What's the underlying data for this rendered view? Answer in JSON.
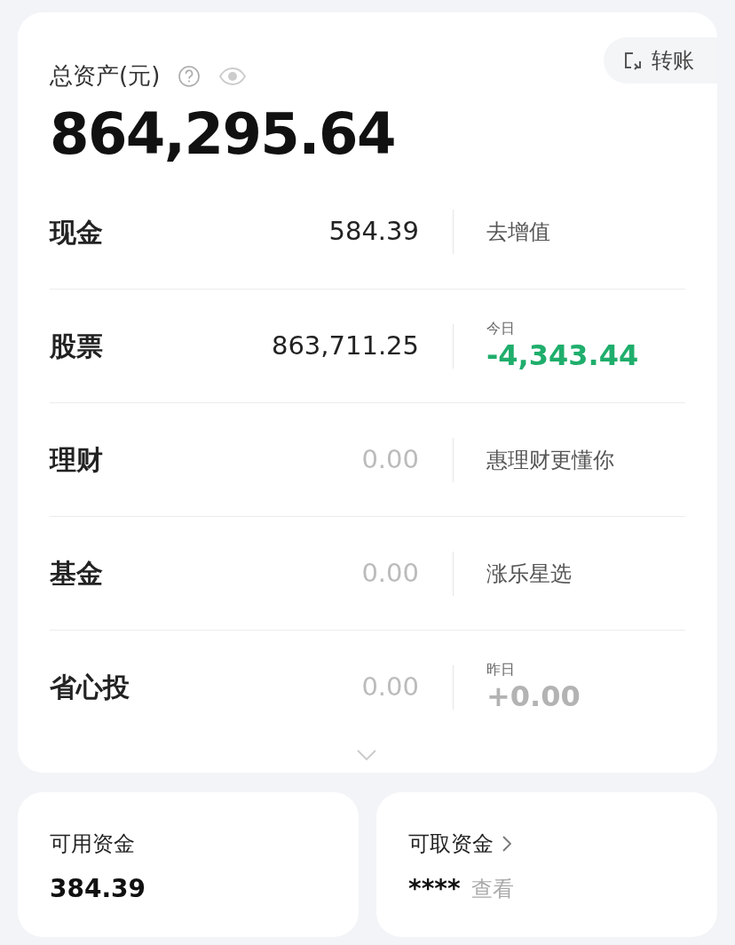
{
  "summary": {
    "title": "总资产(元)",
    "total": "864,295.64",
    "transfer_button": "转账"
  },
  "rows": [
    {
      "name": "现金",
      "amount": "584.39",
      "dimmed": false,
      "side": {
        "kind": "link",
        "text": "去增值"
      }
    },
    {
      "name": "股票",
      "amount": "863,711.25",
      "dimmed": false,
      "side": {
        "kind": "change",
        "label": "今日",
        "value": "-4,343.44",
        "color": "#1fae6c"
      }
    },
    {
      "name": "理财",
      "amount": "0.00",
      "dimmed": true,
      "side": {
        "kind": "link",
        "text": "惠理财更懂你"
      }
    },
    {
      "name": "基金",
      "amount": "0.00",
      "dimmed": true,
      "side": {
        "kind": "link",
        "text": "涨乐星选"
      }
    },
    {
      "name": "省心投",
      "amount": "0.00",
      "dimmed": true,
      "side": {
        "kind": "change",
        "label": "昨日",
        "value": "+0.00",
        "color": "#b3b3b3"
      }
    }
  ],
  "funds": [
    {
      "label": "可用资金",
      "value": "384.39",
      "has_arrow": false
    },
    {
      "label": "可取资金",
      "value": "****",
      "hint": "查看",
      "has_arrow": true
    }
  ]
}
